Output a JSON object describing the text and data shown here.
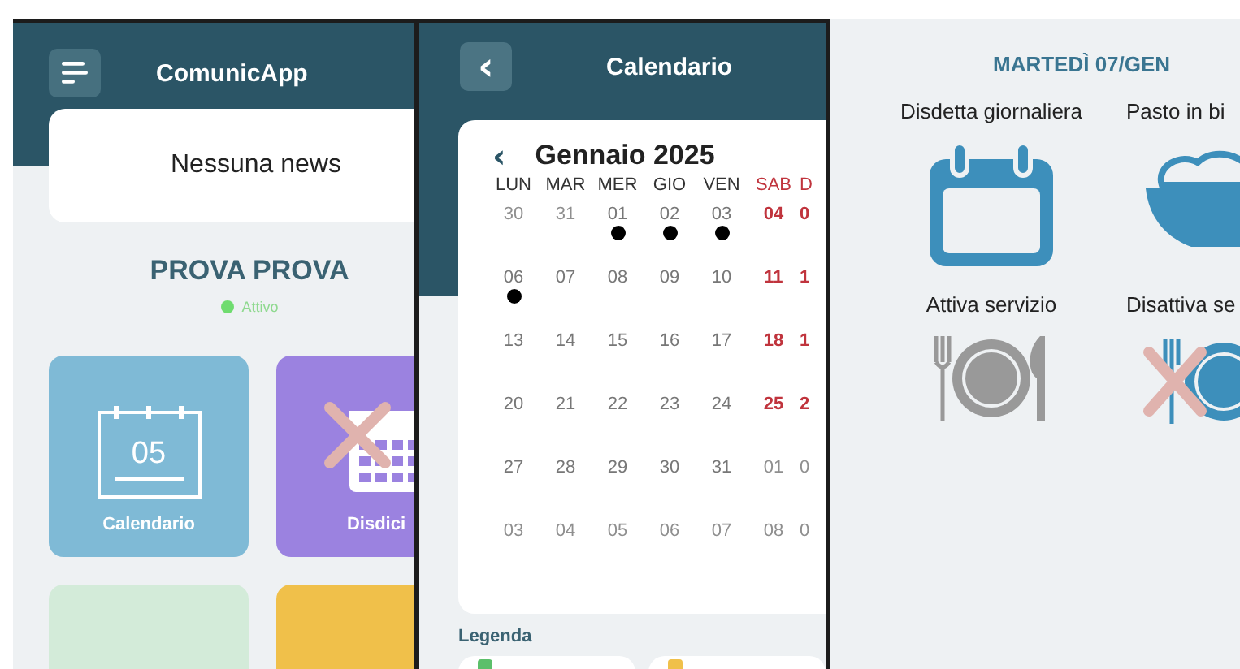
{
  "home": {
    "title": "ComunicApp",
    "news": "Nessuna news",
    "user": {
      "name": "PROVA PROVA",
      "status": "Attivo",
      "active": true
    },
    "tiles": [
      {
        "label": "Calendario",
        "kind": "calendar",
        "color": "#7fbad6",
        "number": "05"
      },
      {
        "label": "Disdici",
        "kind": "cancel",
        "color": "#9b82e0"
      },
      {
        "kind": "blank",
        "color": "#d3ebd9"
      },
      {
        "kind": "document",
        "color": "#f0c04a"
      }
    ]
  },
  "calendar": {
    "title": "Calendario",
    "back": "‹",
    "month": "Gennaio 2025",
    "prev": "‹",
    "weekdays": [
      {
        "label": "LUN",
        "weekend": false
      },
      {
        "label": "MAR",
        "weekend": false
      },
      {
        "label": "MER",
        "weekend": false
      },
      {
        "label": "GIO",
        "weekend": false
      },
      {
        "label": "VEN",
        "weekend": false
      },
      {
        "label": "SAB",
        "weekend": true
      },
      {
        "label": "D",
        "weekend": true
      }
    ],
    "weeks": [
      [
        {
          "day": "30",
          "kind": "other",
          "dot": false
        },
        {
          "day": "31",
          "kind": "other",
          "dot": false
        },
        {
          "day": "01",
          "kind": "normal",
          "dot": true
        },
        {
          "day": "02",
          "kind": "normal",
          "dot": true
        },
        {
          "day": "03",
          "kind": "normal",
          "dot": true
        },
        {
          "day": "04",
          "kind": "weekend",
          "dot": false
        },
        {
          "day": "0",
          "kind": "weekend",
          "dot": false
        }
      ],
      [
        {
          "day": "06",
          "kind": "normal",
          "dot": true
        },
        {
          "day": "07",
          "kind": "normal",
          "dot": false
        },
        {
          "day": "08",
          "kind": "normal",
          "dot": false
        },
        {
          "day": "09",
          "kind": "normal",
          "dot": false
        },
        {
          "day": "10",
          "kind": "normal",
          "dot": false
        },
        {
          "day": "11",
          "kind": "weekend",
          "dot": false
        },
        {
          "day": "1",
          "kind": "weekend",
          "dot": false
        }
      ],
      [
        {
          "day": "13",
          "kind": "normal",
          "dot": false
        },
        {
          "day": "14",
          "kind": "normal",
          "dot": false
        },
        {
          "day": "15",
          "kind": "normal",
          "dot": false
        },
        {
          "day": "16",
          "kind": "normal",
          "dot": false
        },
        {
          "day": "17",
          "kind": "normal",
          "dot": false
        },
        {
          "day": "18",
          "kind": "weekend",
          "dot": false
        },
        {
          "day": "1",
          "kind": "weekend",
          "dot": false
        }
      ],
      [
        {
          "day": "20",
          "kind": "normal",
          "dot": false
        },
        {
          "day": "21",
          "kind": "normal",
          "dot": false
        },
        {
          "day": "22",
          "kind": "normal",
          "dot": false
        },
        {
          "day": "23",
          "kind": "normal",
          "dot": false
        },
        {
          "day": "24",
          "kind": "normal",
          "dot": false
        },
        {
          "day": "25",
          "kind": "weekend",
          "dot": false
        },
        {
          "day": "2",
          "kind": "weekend",
          "dot": false
        }
      ],
      [
        {
          "day": "27",
          "kind": "normal",
          "dot": false
        },
        {
          "day": "28",
          "kind": "normal",
          "dot": false
        },
        {
          "day": "29",
          "kind": "normal",
          "dot": false
        },
        {
          "day": "30",
          "kind": "normal",
          "dot": false
        },
        {
          "day": "31",
          "kind": "normal",
          "dot": false
        },
        {
          "day": "01",
          "kind": "other",
          "dot": false
        },
        {
          "day": "0",
          "kind": "other",
          "dot": false
        }
      ],
      [
        {
          "day": "03",
          "kind": "other",
          "dot": false
        },
        {
          "day": "04",
          "kind": "other",
          "dot": false
        },
        {
          "day": "05",
          "kind": "other",
          "dot": false
        },
        {
          "day": "06",
          "kind": "other",
          "dot": false
        },
        {
          "day": "07",
          "kind": "other",
          "dot": false
        },
        {
          "day": "08",
          "kind": "other",
          "dot": false
        },
        {
          "day": "0",
          "kind": "other",
          "dot": false
        }
      ]
    ],
    "legend": "Legenda"
  },
  "day": {
    "title": "MARTEDÌ 07/GEN",
    "options": [
      {
        "label": "Disdetta giornaliera",
        "kind": "calendar"
      },
      {
        "label": "Pasto in bi",
        "kind": "bowl"
      },
      {
        "label": "Attiva servizio",
        "kind": "plate"
      },
      {
        "label": "Disattiva se",
        "kind": "plate-off"
      }
    ]
  }
}
